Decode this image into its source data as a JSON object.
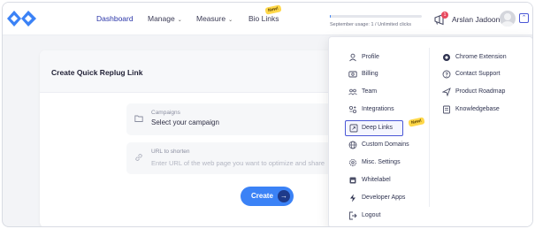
{
  "nav": {
    "items": [
      {
        "label": "Dashboard",
        "has_dropdown": false,
        "active": true
      },
      {
        "label": "Manage",
        "has_dropdown": true,
        "active": false
      },
      {
        "label": "Measure",
        "has_dropdown": true,
        "active": false
      },
      {
        "label": "Bio Links",
        "has_dropdown": false,
        "active": false
      }
    ],
    "bio_links_badge": "New!"
  },
  "usage": {
    "text": "September usage: 1 / Unlimited clicks",
    "progress_fraction": 0.01
  },
  "notifications": {
    "count": "1"
  },
  "user": {
    "name": "Arslan Jadoon"
  },
  "card": {
    "title": "Create Quick Replug Link",
    "campaign_field": {
      "label": "Campaigns",
      "value": "Select your campaign"
    },
    "url_field": {
      "label": "URL to shorten",
      "placeholder": "Enter URL of the web page you want to optimize and share"
    },
    "create_label": "Create",
    "create_arrow": "→"
  },
  "dropdown": {
    "left_items": [
      {
        "label": "Profile",
        "icon": "user-icon"
      },
      {
        "label": "Billing",
        "icon": "billing-icon"
      },
      {
        "label": "Team",
        "icon": "team-icon"
      },
      {
        "label": "Integrations",
        "icon": "integrations-icon"
      },
      {
        "label": "Deep Links",
        "icon": "deep-links-icon",
        "badge": "New!",
        "highlighted": true
      },
      {
        "label": "Custom Domains",
        "icon": "globe-icon"
      },
      {
        "label": "Misc. Settings",
        "icon": "settings-icon"
      },
      {
        "label": "Whitelabel",
        "icon": "whitelabel-icon"
      },
      {
        "label": "Developer Apps",
        "icon": "developer-icon"
      },
      {
        "label": "Logout",
        "icon": "logout-icon"
      }
    ],
    "right_items": [
      {
        "label": "Chrome Extension",
        "icon": "chrome-icon"
      },
      {
        "label": "Contact Support",
        "icon": "support-icon"
      },
      {
        "label": "Product Roadmap",
        "icon": "roadmap-icon"
      },
      {
        "label": "Knowledgebase",
        "icon": "knowledgebase-icon"
      }
    ]
  },
  "colors": {
    "brand": "#3b82f6",
    "nav_active": "#2a35a8",
    "badge_yellow": "#ffd84a",
    "notification_red": "#e84a5f"
  }
}
